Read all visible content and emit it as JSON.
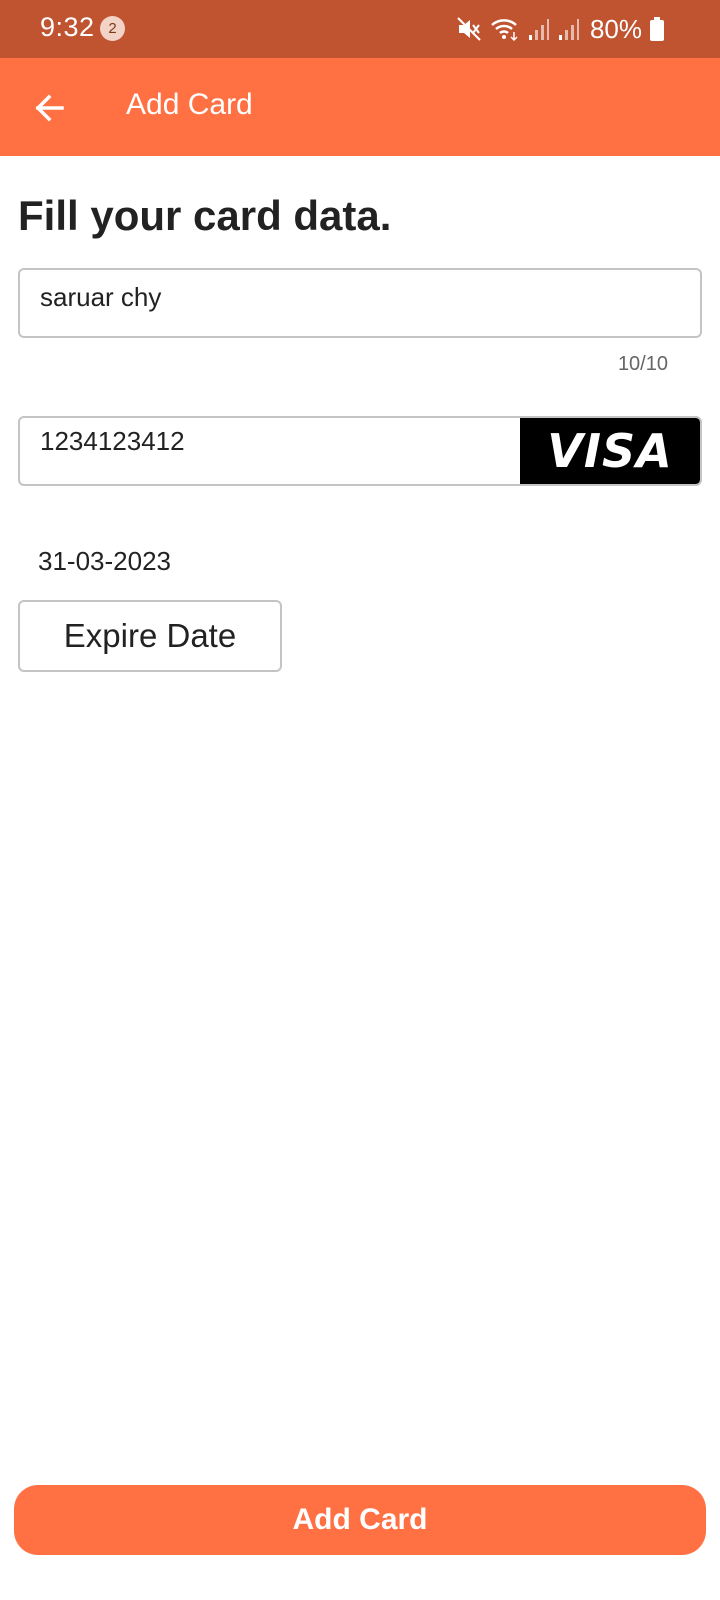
{
  "status_bar": {
    "time": "9:32",
    "notification_count": "2",
    "battery": "80%",
    "icons": [
      "mute-icon",
      "wifi-icon",
      "signal-icon",
      "signal-icon",
      "battery-icon"
    ]
  },
  "app_bar": {
    "back_icon": "arrow-left-icon",
    "title": "Add Card",
    "color": "#ff7043"
  },
  "form": {
    "heading": "Fill your card data.",
    "name_value": "saruar chy",
    "name_counter": "10/10",
    "card_number_value": "1234123412",
    "card_brand": "VISA",
    "expire_date_value": "31-03-2023",
    "expire_date_button": "Expire Date"
  },
  "footer": {
    "submit_label": "Add Card"
  },
  "colors": {
    "status_bar": "#c05431",
    "accent": "#ff7043"
  }
}
